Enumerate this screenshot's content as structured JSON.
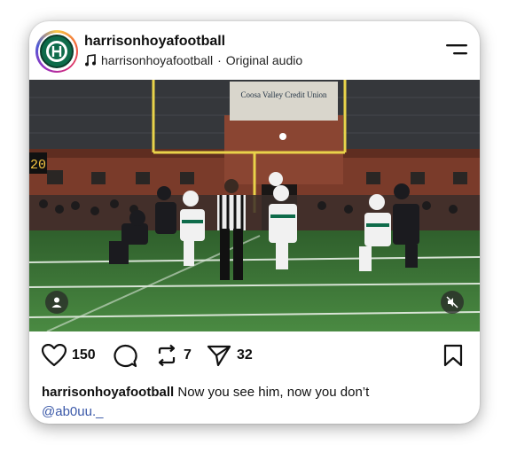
{
  "post": {
    "username": "harrisonhoyafootball",
    "audio_artist": "harrisonhoyafootball",
    "audio_separator": "·",
    "audio_label": "Original audio",
    "caption_username": "harrisonhoyafootball",
    "caption_text": "Now you see him, now you don’t",
    "caption_mention": "@ab0uu._"
  },
  "media": {
    "banner_text": "Coosa Valley Credit Union",
    "scoreboard_text": "20"
  },
  "actions": {
    "likes": "150",
    "reposts": "7",
    "shares": "32"
  },
  "icons": {
    "like": "heart-icon",
    "comment": "comment-icon",
    "repost": "repost-icon",
    "share": "send-icon",
    "save": "bookmark-icon",
    "audio": "music-note-icon",
    "menu": "menu-icon",
    "user_tag": "person-icon",
    "mute": "muted-speaker-icon"
  },
  "colors": {
    "field": "#3f7a3a",
    "wall": "#7a3b2a",
    "goalpost": "#e9d34a",
    "mention": "#3a58a8",
    "team_green": "#0e6b4a"
  }
}
